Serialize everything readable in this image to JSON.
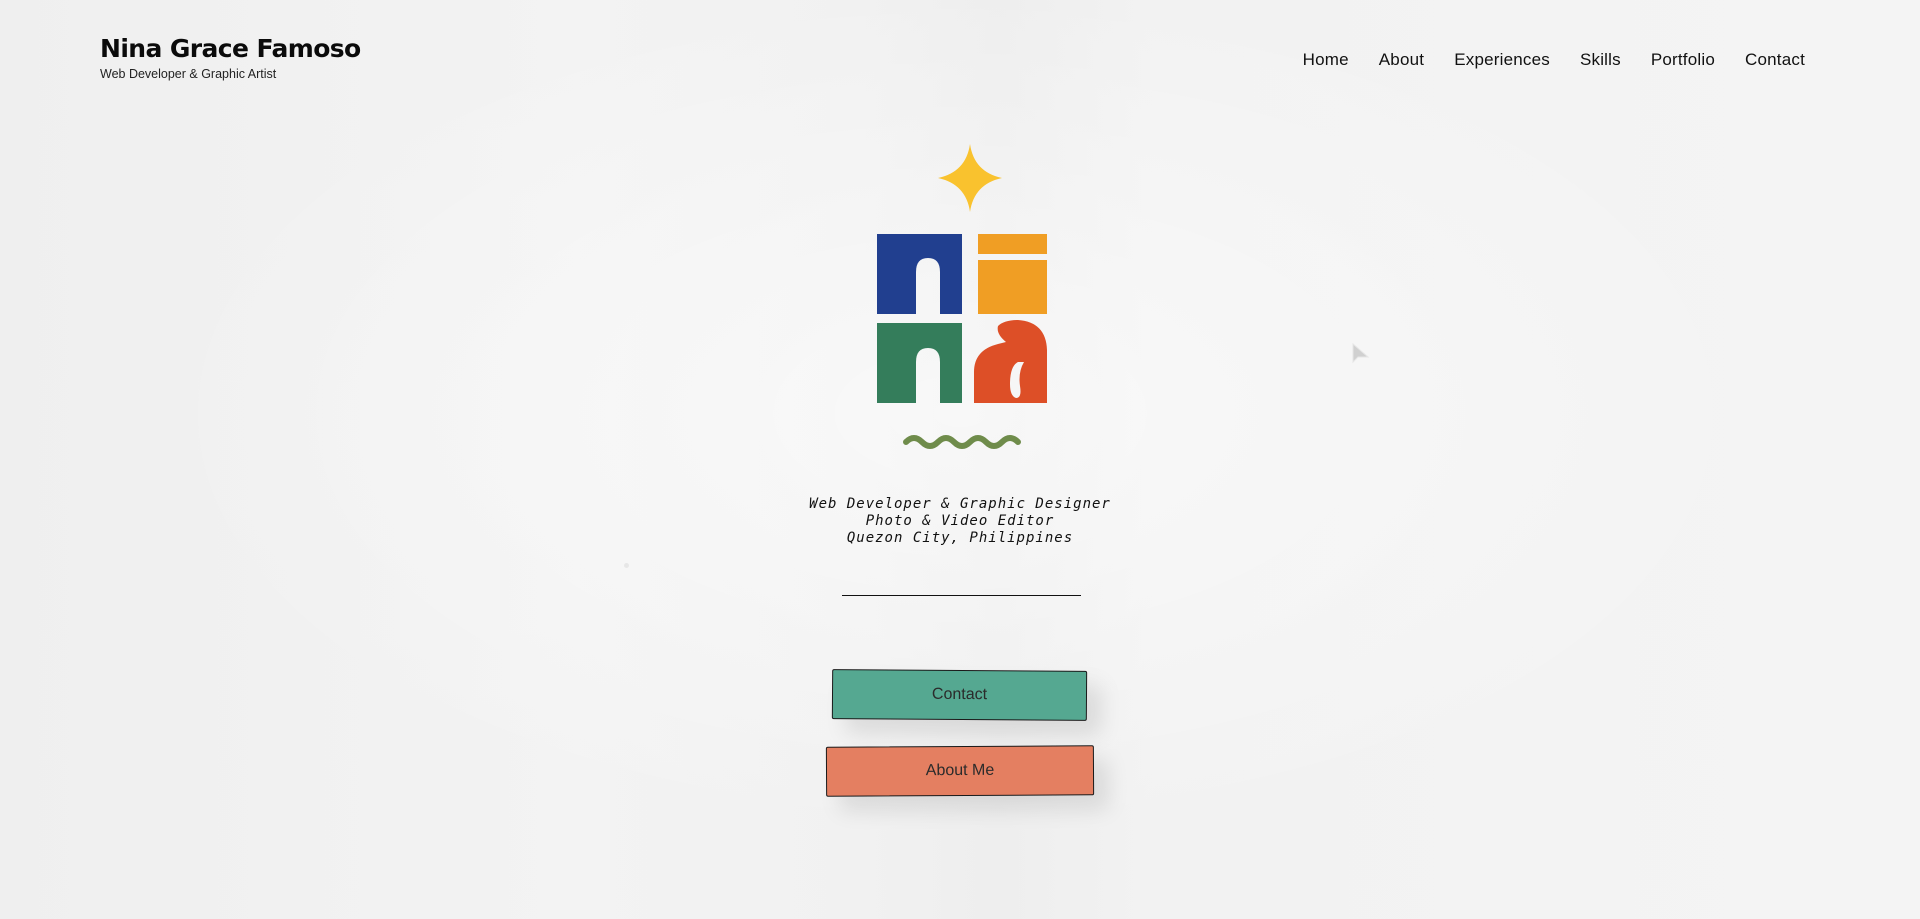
{
  "header": {
    "name": "Nina Grace Famoso",
    "tagline": "Web Developer & Graphic Artist"
  },
  "nav": {
    "items": [
      "Home",
      "About",
      "Experiences",
      "Skills",
      "Portfolio",
      "Contact"
    ]
  },
  "logo": {
    "letters": [
      "n",
      "i",
      "n",
      "a"
    ],
    "colors": {
      "star": "#f9c22e",
      "n_top": "#213f8f",
      "i": "#f09e24",
      "n_bottom": "#347d5b",
      "a": "#dd4f27",
      "wave": "#6f8c4b"
    }
  },
  "hero": {
    "lines": [
      "Web Developer & Graphic Designer",
      "Photo & Video Editor",
      "Quezon City, Philippines"
    ]
  },
  "buttons": {
    "contact": "Contact",
    "about": "About Me"
  },
  "colors": {
    "contact_button": "#55a891",
    "about_button": "#e47f61"
  }
}
